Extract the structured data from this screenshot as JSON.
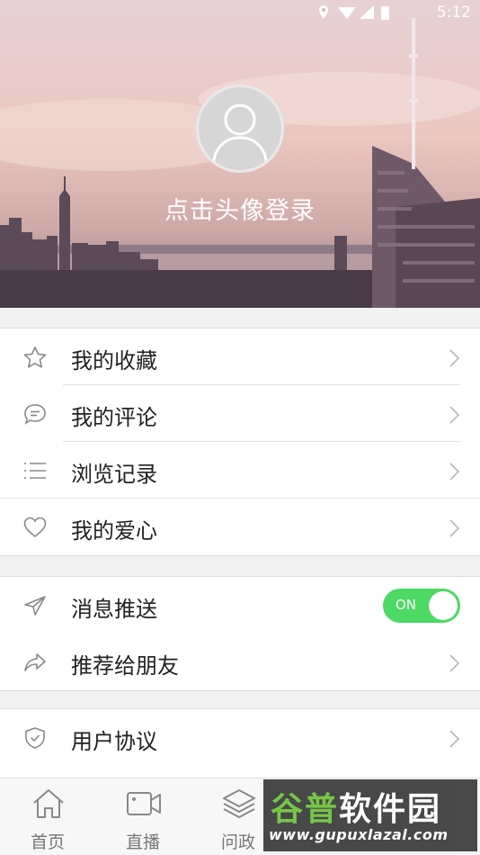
{
  "status_bar": {
    "time": "5:12"
  },
  "profile": {
    "login_prompt": "点击头像登录"
  },
  "menu_group_1": [
    {
      "label": "我的收藏",
      "icon": "star-icon"
    },
    {
      "label": "我的评论",
      "icon": "comment-icon"
    },
    {
      "label": "浏览记录",
      "icon": "list-icon"
    },
    {
      "label": "我的爱心",
      "icon": "heart-icon"
    }
  ],
  "menu_group_2": [
    {
      "label": "消息推送",
      "icon": "send-icon",
      "toggle": {
        "state": "ON",
        "on": true
      }
    },
    {
      "label": "推荐给朋友",
      "icon": "share-icon"
    }
  ],
  "menu_group_3": [
    {
      "label": "用户协议",
      "icon": "shield-icon"
    }
  ],
  "bottom_nav": [
    {
      "label": "首页",
      "icon": "home-icon"
    },
    {
      "label": "直播",
      "icon": "video-icon"
    },
    {
      "label": "问政",
      "icon": "layers-icon"
    }
  ],
  "watermark": {
    "brand_a": "谷普",
    "brand_b": "软件园",
    "url": "www.gupuxlazal.com"
  },
  "colors": {
    "toggle_on": "#4cd964",
    "text_primary": "#222222",
    "icon_gray": "#888888"
  }
}
